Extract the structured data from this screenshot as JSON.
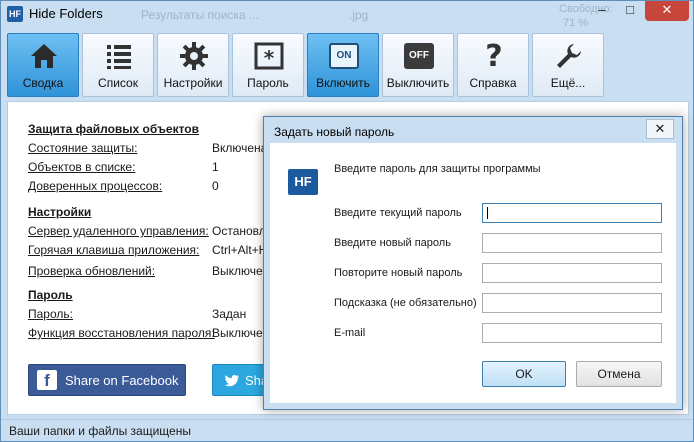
{
  "window": {
    "app_icon": "HF",
    "title": "Hide Folders",
    "background_text": [
      "Результаты поиска ...",
      ".jpg",
      "Свободно:",
      "71 %"
    ],
    "controls": {
      "minimize": "–",
      "maximize": "□",
      "close": "✕"
    }
  },
  "toolbar": {
    "items": [
      {
        "label": "Сводка",
        "icon": "home-icon",
        "active": true
      },
      {
        "label": "Список",
        "icon": "list-icon",
        "active": false
      },
      {
        "label": "Настройки",
        "icon": "gear-icon",
        "active": false
      },
      {
        "label": "Пароль",
        "icon": "password-icon",
        "active": false
      },
      {
        "label": "Включить",
        "icon": "on-switch-icon",
        "active": true,
        "icon_text": "ON"
      },
      {
        "label": "Выключить",
        "icon": "off-switch-icon",
        "active": false,
        "icon_text": "OFF"
      },
      {
        "label": "Справка",
        "icon": "help-icon",
        "active": false,
        "icon_text": "?"
      },
      {
        "label": "Ещё...",
        "icon": "wrench-icon",
        "active": false
      }
    ]
  },
  "summary": {
    "protection": {
      "heading": "Защита файловых объектов",
      "rows": [
        {
          "label": "Состояние защиты:",
          "value": "Включена"
        },
        {
          "label": "Объектов в списке:",
          "value": "1"
        },
        {
          "label": "Доверенных процессов:",
          "value": "0"
        }
      ]
    },
    "settings": {
      "heading": "Настройки",
      "rows": [
        {
          "label": "Сервер удаленного управления:",
          "value": "Остановле"
        },
        {
          "label": "Горячая клавиша приложения:",
          "value": "Ctrl+Alt+H"
        },
        {
          "label": "Проверка обновлений:",
          "value": "Выключен"
        }
      ]
    },
    "password": {
      "heading": "Пароль",
      "rows": [
        {
          "label": "Пароль:",
          "value": "Задан"
        },
        {
          "label": "Функция восстановления пароля:",
          "value": "Выключен"
        }
      ]
    },
    "facebook_label": "Share on Facebook",
    "facebook_icon": "f",
    "twitter_label": "Sha"
  },
  "status": {
    "text": "Ваши папки и файлы защищены"
  },
  "dialog": {
    "title": "Задать новый пароль",
    "close": "✕",
    "logo": "HF",
    "intro": "Введите пароль для защиты программы",
    "fields": [
      {
        "label": "Введите текущий пароль",
        "value": ""
      },
      {
        "label": "Введите новый пароль",
        "value": ""
      },
      {
        "label": "Повторите новый пароль",
        "value": ""
      },
      {
        "label": "Подсказка (не обязательно)",
        "value": ""
      },
      {
        "label": "E-mail",
        "value": ""
      }
    ],
    "ok_label": "OK",
    "cancel_label": "Отмена"
  },
  "colors": {
    "accent": "#2f93d8",
    "facebook": "#3b5a98",
    "twitter": "#2ca7e0"
  }
}
